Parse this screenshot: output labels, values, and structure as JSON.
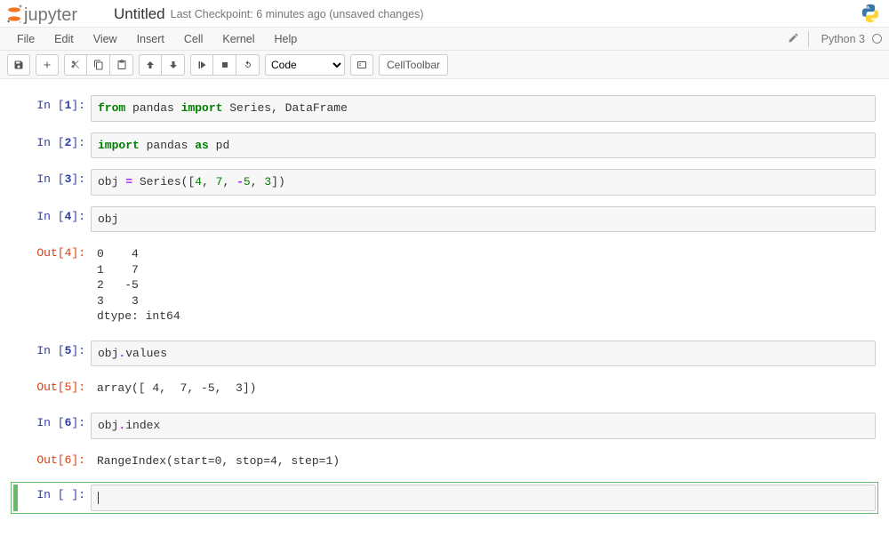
{
  "header": {
    "app": "jupyter",
    "title": "Untitled",
    "checkpoint": "Last Checkpoint: 6 minutes ago (unsaved changes)"
  },
  "menubar": {
    "items": [
      "File",
      "Edit",
      "View",
      "Insert",
      "Cell",
      "Kernel",
      "Help"
    ],
    "kernel_name": "Python 3"
  },
  "toolbar": {
    "cell_type_value": "Code",
    "celltoolbar_label": "CellToolbar"
  },
  "cells": [
    {
      "type": "code",
      "exec": 1,
      "source_tokens": [
        [
          "kw-green",
          "from"
        ],
        [
          "",
          " pandas "
        ],
        [
          "kw-green",
          "import"
        ],
        [
          "",
          " Series, DataFrame"
        ]
      ]
    },
    {
      "type": "code",
      "exec": 2,
      "source_tokens": [
        [
          "kw-green",
          "import"
        ],
        [
          "",
          " pandas "
        ],
        [
          "kw-green",
          "as"
        ],
        [
          "",
          " pd"
        ]
      ]
    },
    {
      "type": "code",
      "exec": 3,
      "source_tokens": [
        [
          "",
          "obj "
        ],
        [
          "op",
          "="
        ],
        [
          "",
          " Series(["
        ],
        [
          "num-lit",
          "4"
        ],
        [
          "",
          ", "
        ],
        [
          "num-lit",
          "7"
        ],
        [
          "",
          ", "
        ],
        [
          "op",
          "-"
        ],
        [
          "num-lit",
          "5"
        ],
        [
          "",
          ", "
        ],
        [
          "num-lit",
          "3"
        ],
        [
          "",
          "])"
        ]
      ]
    },
    {
      "type": "code",
      "exec": 4,
      "source_tokens": [
        [
          "",
          "obj"
        ]
      ],
      "output": "0    4\n1    7\n2   -5\n3    3\ndtype: int64"
    },
    {
      "type": "code",
      "exec": 5,
      "source_tokens": [
        [
          "",
          "obj"
        ],
        [
          "op",
          "."
        ],
        [
          "",
          "values"
        ]
      ],
      "output": "array([ 4,  7, -5,  3])"
    },
    {
      "type": "code",
      "exec": 6,
      "source_tokens": [
        [
          "",
          "obj"
        ],
        [
          "op",
          "."
        ],
        [
          "",
          "index"
        ]
      ],
      "output": "RangeIndex(start=0, stop=4, step=1)"
    },
    {
      "type": "code",
      "exec": null,
      "source_tokens": [],
      "selected": true
    }
  ]
}
